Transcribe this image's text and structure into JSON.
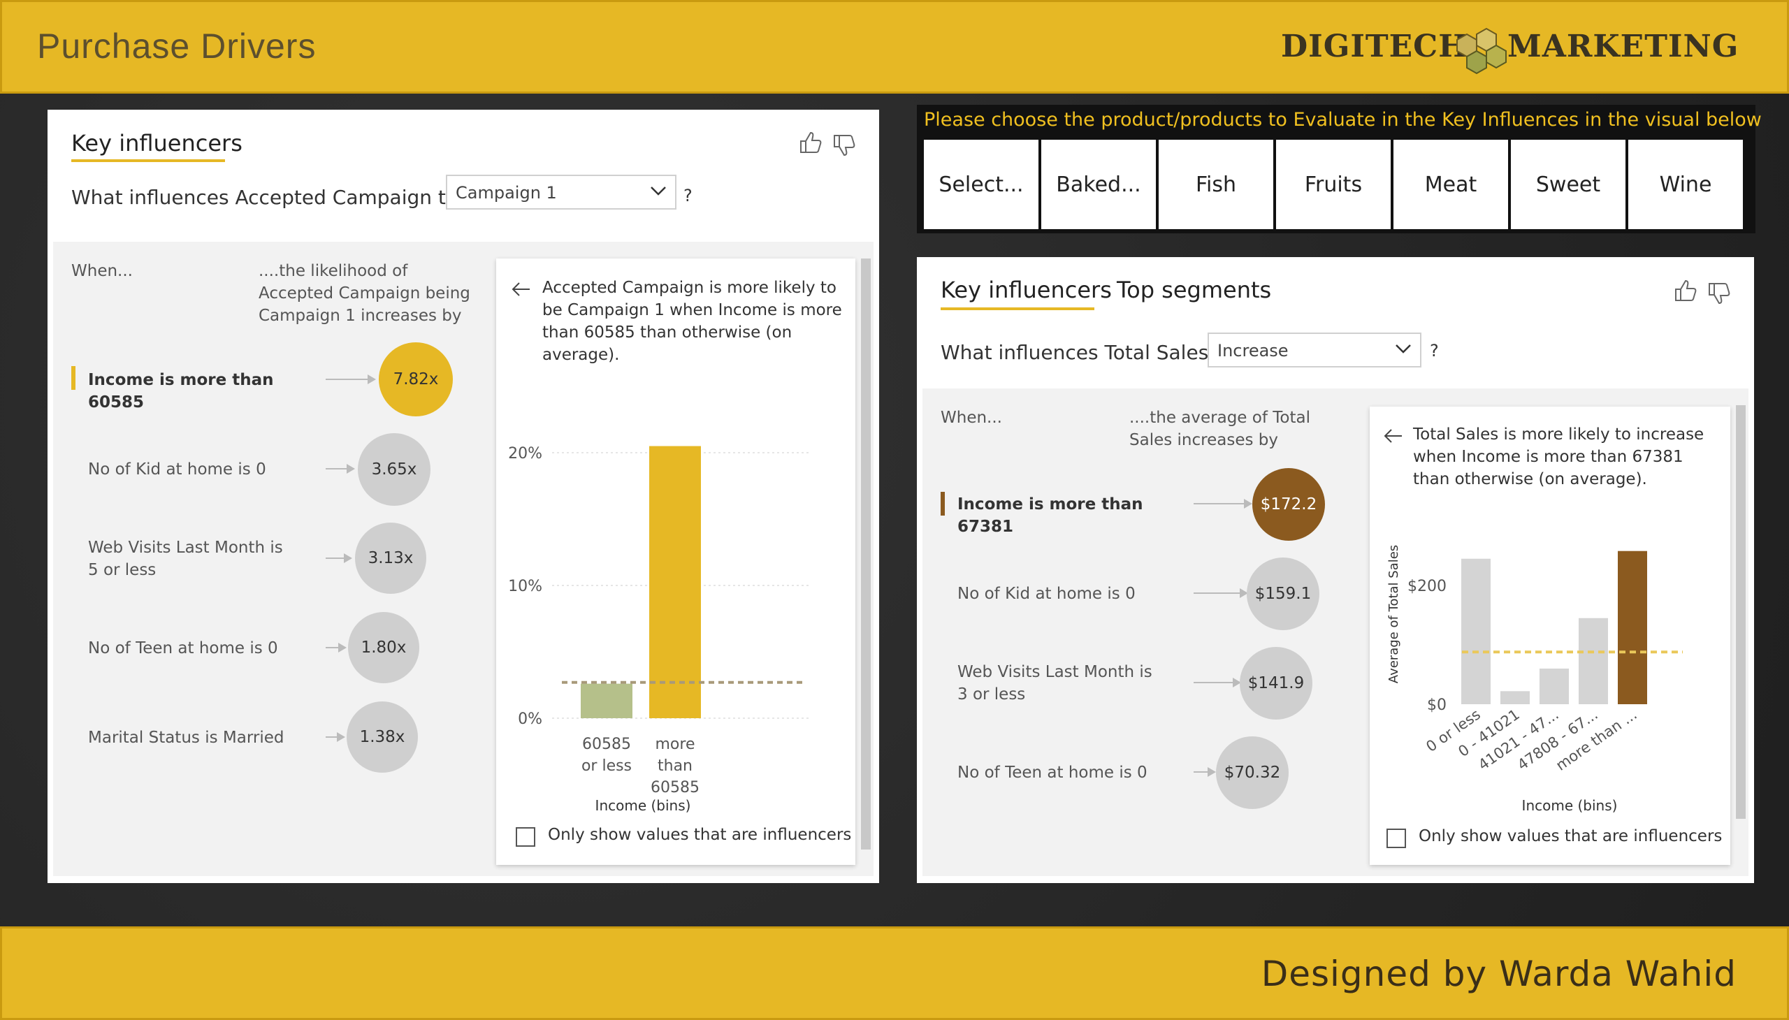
{
  "header": {
    "title": "Purchase Drivers",
    "brand_left": "DIGITECH",
    "brand_right": "MARKETING"
  },
  "footer": {
    "credit": "Designed by Warda Wahid"
  },
  "colors": {
    "accent": "#e6b825",
    "brown": "#8b5a1f",
    "olive": "#b5c08a",
    "bubble_grey": "#cfcfcf"
  },
  "left_panel": {
    "tab": "Key influencers",
    "question_prefix": "What influences Accepted Campaign to be",
    "question_suffix": "?",
    "dropdown_value": "Campaign 1",
    "col_when": "When...",
    "col_likelihood": "....the likelihood of Accepted Campaign being Campaign 1 increases by",
    "influencers": [
      {
        "label": "Income is more than 60585",
        "value": "7.82x"
      },
      {
        "label": "No of Kid at home is 0",
        "value": "3.65x"
      },
      {
        "label": "Web Visits Last Month is 5 or less",
        "value": "3.13x"
      },
      {
        "label": "No of Teen at home is 0",
        "value": "1.80x"
      },
      {
        "label": "Marital Status is Married",
        "value": "1.38x"
      }
    ],
    "detail_text": "Accepted Campaign is more likely to be Campaign 1 when Income is more than 60585 than otherwise (on average).",
    "checkbox_label": "Only show values that are influencers"
  },
  "right_panel": {
    "slicer_title": "Please choose the product/products to Evaluate in the Key Influences in the visual below",
    "slicer_items": [
      "Select...",
      "Baked...",
      "Fish",
      "Fruits",
      "Meat",
      "Sweet",
      "Wine"
    ],
    "tab_active": "Key influencers",
    "tab_other": "Top segments",
    "question_prefix": "What influences Total Sales to",
    "question_suffix": "?",
    "dropdown_value": "Increase",
    "col_when": "When...",
    "col_average": "....the average of Total Sales increases by",
    "influencers": [
      {
        "label": "Income is more than 67381",
        "value": "$172.2"
      },
      {
        "label": "No of Kid at home is 0",
        "value": "$159.1"
      },
      {
        "label": "Web Visits Last Month is 3 or less",
        "value": "$141.9"
      },
      {
        "label": "No of Teen at home is 0",
        "value": "$70.32"
      }
    ],
    "detail_text": "Total Sales is more likely to increase when Income is more than 67381 than otherwise (on average).",
    "checkbox_label": "Only show values that are influencers"
  },
  "chart_data": [
    {
      "type": "bar",
      "categories": [
        "60585 or less",
        "more than 60585"
      ],
      "values": [
        2.6,
        20.5
      ],
      "reference_line": 2.7,
      "xlabel": "Income (bins)",
      "ylabel": "",
      "yticks": [
        "0%",
        "10%",
        "20%"
      ],
      "ylim": [
        0,
        22
      ],
      "colors": [
        "#b5c08a",
        "#e6b825"
      ]
    },
    {
      "type": "bar",
      "categories": [
        "0 or less",
        "0 - 41021",
        "41021 - 47...",
        "47808 - 67...",
        "more than ..."
      ],
      "values": [
        245,
        22,
        60,
        145,
        258
      ],
      "reference_line": 88,
      "xlabel": "Income (bins)",
      "ylabel": "Average of Total Sales",
      "yticks": [
        "$0",
        "$200"
      ],
      "ylim": [
        0,
        280
      ],
      "colors": [
        "#d4d4d4",
        "#d4d4d4",
        "#d4d4d4",
        "#d4d4d4",
        "#8b5a1f"
      ]
    }
  ]
}
